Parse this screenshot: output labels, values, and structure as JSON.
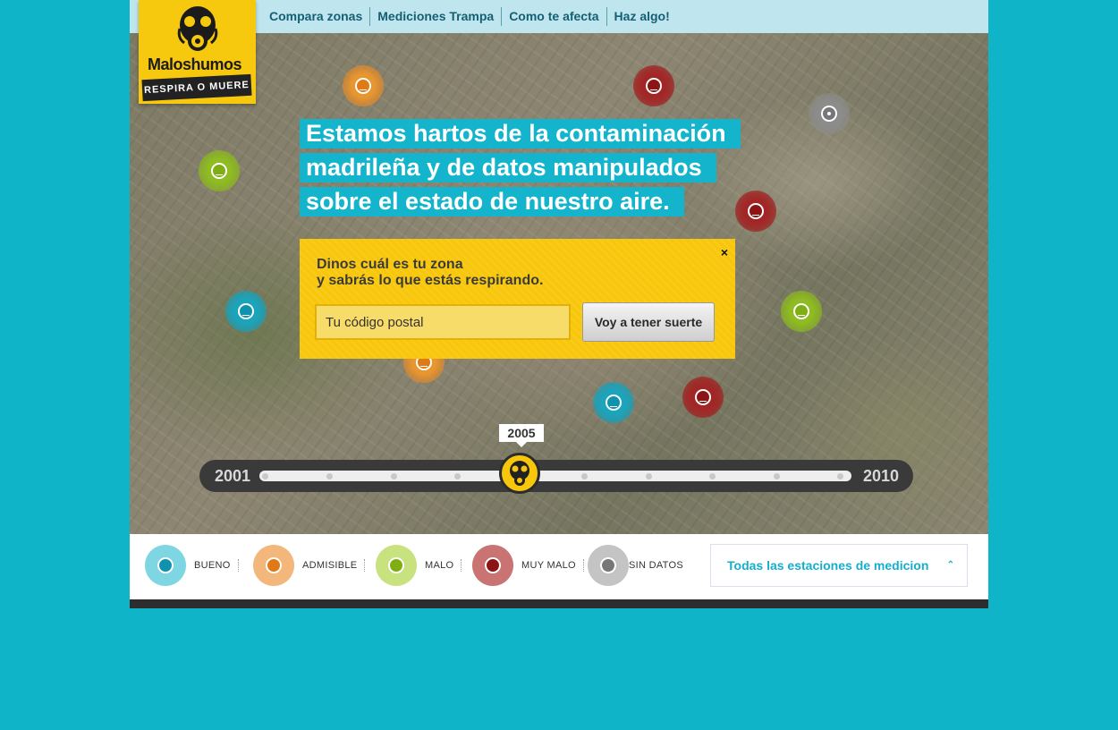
{
  "brand": {
    "name_a": "Malos",
    "name_b": "humos",
    "tagline": "RESPIRA O MUERE"
  },
  "nav": {
    "items": [
      "Compara zonas",
      "Mediciones Trampa",
      "Como te afecta",
      "Haz algo!"
    ]
  },
  "headline": {
    "lines": [
      "Estamos hartos de la contaminación",
      "madrileña y de datos manipulados",
      "sobre el estado de nuestro aire."
    ]
  },
  "panel": {
    "line1": "Dinos cuál es tu zona",
    "line2": "y sabrás lo que estás respirando.",
    "input_placeholder": "Tu código postal",
    "button_label": "Voy a tener suerte",
    "close_glyph": "×"
  },
  "timeline": {
    "start_year": "2001",
    "end_year": "2010",
    "selected_year": "2005",
    "selected_fraction": 0.44
  },
  "legend": {
    "items": [
      {
        "label": "BUENO",
        "color": "#7fd6e3",
        "face": "#0f93ad"
      },
      {
        "label": "ADMISIBLE",
        "color": "#f3b77c",
        "face": "#e07a16"
      },
      {
        "label": "MALO",
        "color": "#c7e27f",
        "face": "#7fae12"
      },
      {
        "label": "MUY MALO",
        "color": "#c97373",
        "face": "#8c1414"
      },
      {
        "label": "SIN DATOS",
        "color": "#c4c4c4",
        "face": "#777777"
      }
    ]
  },
  "stations": {
    "label": "Todas las estaciones de medicion",
    "chevron": "⌃"
  },
  "colors": {
    "accent": "#14b5cc",
    "brand_yellow": "#f8c70c",
    "background": "#10b4c8"
  }
}
